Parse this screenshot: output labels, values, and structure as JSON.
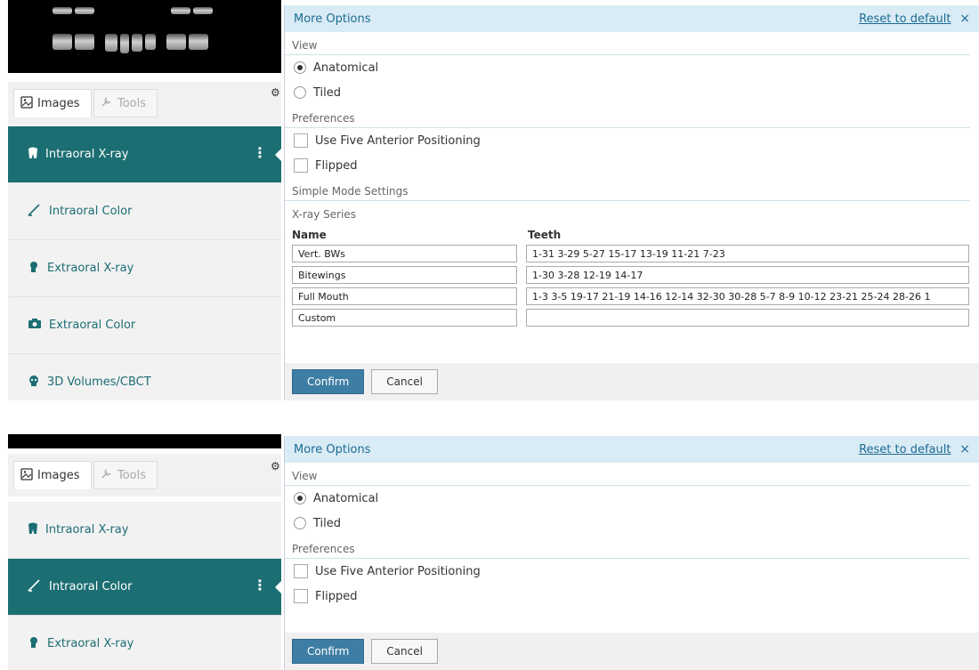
{
  "panel1": {
    "tabs": {
      "images": "Images",
      "tools": "Tools"
    },
    "menu": [
      {
        "label": "Intraoral X-ray",
        "icon": "tooth-icon",
        "active": true
      },
      {
        "label": "Intraoral Color",
        "icon": "brush-icon",
        "active": false
      },
      {
        "label": "Extraoral X-ray",
        "icon": "head-icon",
        "active": false
      },
      {
        "label": "Extraoral Color",
        "icon": "camera-icon",
        "active": false
      },
      {
        "label": "3D Volumes/CBCT",
        "icon": "skull-icon",
        "active": false
      }
    ],
    "options": {
      "title": "More Options",
      "reset": "Reset to default",
      "close": "×",
      "view_label": "View",
      "view_options": [
        "Anatomical",
        "Tiled"
      ],
      "preferences_label": "Preferences",
      "pref_five_anterior": "Use Five Anterior Positioning",
      "pref_flipped": "Flipped",
      "simple_mode_label": "Simple Mode Settings",
      "xray_series_label": "X-ray Series",
      "col_name": "Name",
      "col_teeth": "Teeth",
      "series": [
        {
          "name": "Vert. BWs",
          "teeth": "1-31 3-29 5-27 15-17 13-19 11-21 7-23"
        },
        {
          "name": "Bitewings",
          "teeth": "1-30 3-28 12-19 14-17"
        },
        {
          "name": "Full Mouth",
          "teeth": "1-3 3-5 19-17 21-19 14-16 12-14 32-30 30-28 5-7 8-9 10-12 23-21 25-24 28-26 1"
        },
        {
          "name": "Custom",
          "teeth": ""
        }
      ],
      "confirm": "Confirm",
      "cancel": "Cancel"
    }
  },
  "panel2": {
    "tabs": {
      "images": "Images",
      "tools": "Tools"
    },
    "menu": [
      {
        "label": "Intraoral X-ray",
        "icon": "tooth-icon",
        "active": false
      },
      {
        "label": "Intraoral Color",
        "icon": "brush-icon",
        "active": true
      },
      {
        "label": "Extraoral X-ray",
        "icon": "head-icon",
        "active": false
      }
    ],
    "options": {
      "title": "More Options",
      "reset": "Reset to default",
      "close": "×",
      "view_label": "View",
      "view_options": [
        "Anatomical",
        "Tiled"
      ],
      "preferences_label": "Preferences",
      "pref_five_anterior": "Use Five Anterior Positioning",
      "pref_flipped": "Flipped",
      "confirm": "Confirm",
      "cancel": "Cancel"
    }
  },
  "colors": {
    "teal": "#1b6e72",
    "header_bg": "#d9ebf5",
    "link": "#1d6c94",
    "confirm": "#3f7ea4"
  }
}
